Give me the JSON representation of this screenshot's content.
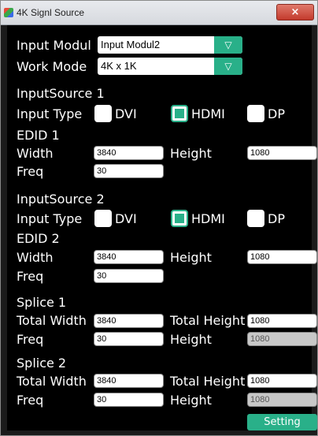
{
  "window": {
    "title": "4K Signl Source",
    "close_glyph": "×",
    "app_icon": "app-icon"
  },
  "input_modul": {
    "label": "Input Modul",
    "value": "Input Modul2",
    "arrow": "▽"
  },
  "work_mode": {
    "label": "Work Mode",
    "value": "4K x 1K",
    "arrow": "▽"
  },
  "source1": {
    "title": "InputSource 1",
    "input_type_label": "Input Type",
    "options": [
      {
        "label": "DVI",
        "selected": false
      },
      {
        "label": "HDMI",
        "selected": true
      },
      {
        "label": "DP",
        "selected": false
      }
    ],
    "edid_title": "EDID 1",
    "width_label": "Width",
    "width": "3840",
    "height_label": "Height",
    "height": "1080",
    "freq_label": "Freq",
    "freq": "30"
  },
  "source2": {
    "title": "InputSource 2",
    "input_type_label": "Input Type",
    "options": [
      {
        "label": "DVI",
        "selected": false
      },
      {
        "label": "HDMI",
        "selected": true
      },
      {
        "label": "DP",
        "selected": false
      }
    ],
    "edid_title": "EDID 2",
    "width_label": "Width",
    "width": "3840",
    "height_label": "Height",
    "height": "1080",
    "freq_label": "Freq",
    "freq": "30"
  },
  "splice1": {
    "title": "Splice 1",
    "total_width_label": "Total Width",
    "total_width": "3840",
    "total_height_label": "Total Height",
    "total_height": "1080",
    "freq_label": "Freq",
    "freq": "30",
    "height_label": "Height",
    "height": "1080"
  },
  "splice2": {
    "title": "Splice 2",
    "total_width_label": "Total Width",
    "total_width": "3840",
    "total_height_label": "Total Height",
    "total_height": "1080",
    "freq_label": "Freq",
    "freq": "30",
    "height_label": "Height",
    "height": "1080"
  },
  "setting_button": "Setting",
  "colors": {
    "accent": "#29b089",
    "background": "#000000",
    "text": "#ffffff"
  }
}
